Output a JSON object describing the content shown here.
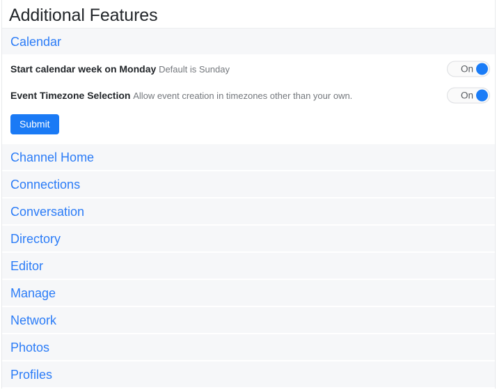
{
  "header": {
    "title": "Additional Features"
  },
  "expanded_section": {
    "name": "Calendar",
    "features": [
      {
        "label": "Start calendar week on Monday",
        "description": "Default is Sunday",
        "toggle_state": "On",
        "toggle_name": "start-calendar-week-on-monday-toggle"
      },
      {
        "label": "Event Timezone Selection",
        "description": "Allow event creation in timezones other than your own.",
        "toggle_state": "On",
        "toggle_name": "event-timezone-selection-toggle"
      }
    ],
    "submit_label": "Submit"
  },
  "collapsed_sections": [
    {
      "name": "Channel Home"
    },
    {
      "name": "Connections"
    },
    {
      "name": "Conversation"
    },
    {
      "name": "Directory"
    },
    {
      "name": "Editor"
    },
    {
      "name": "Manage"
    },
    {
      "name": "Network"
    },
    {
      "name": "Photos"
    },
    {
      "name": "Profiles"
    }
  ],
  "colors": {
    "link": "#2b7cf7",
    "accent": "#1a7af5",
    "toggle_knob": "#1a7cf7",
    "row_background": "#f6f7f9",
    "title": "#22262a"
  }
}
